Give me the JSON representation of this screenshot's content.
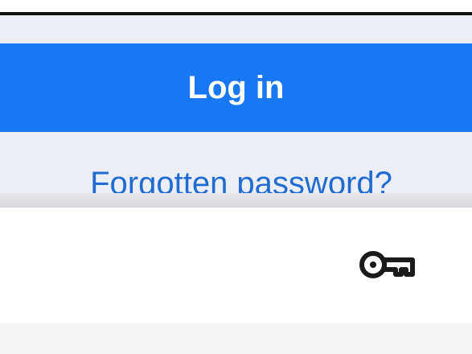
{
  "login": {
    "button_label": "Log in",
    "forgot_password_label": "Forgotten password?"
  },
  "autofill": {
    "icon": "key-icon"
  },
  "colors": {
    "primary": "#1877f2",
    "link": "#1f6bd1",
    "background": "#eceef6"
  }
}
